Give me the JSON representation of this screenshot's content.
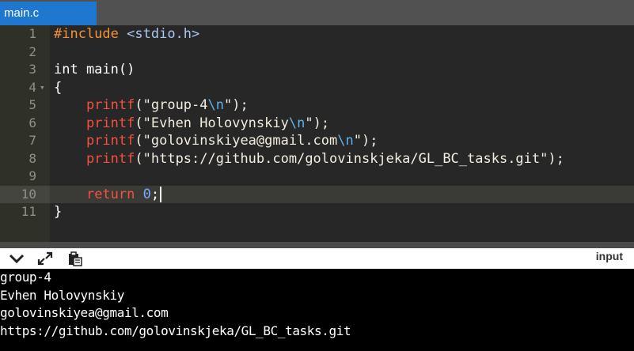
{
  "tab": {
    "label": "main.c"
  },
  "editor": {
    "line_numbers": [
      "1",
      "2",
      "3",
      "4",
      "5",
      "6",
      "7",
      "8",
      "9",
      "10",
      "11"
    ],
    "lines": [
      {
        "include_kw": "#include",
        "header": "<stdio.h>"
      },
      {},
      {
        "text": "int main()"
      },
      {
        "text": "{"
      },
      {
        "fn": "printf",
        "open": "(\"",
        "str": "group-4",
        "esc": "\\n",
        "close": "\");"
      },
      {
        "fn": "printf",
        "open": "(\"",
        "str": "Evhen Holovynskiy",
        "esc": "\\n",
        "close": "\");"
      },
      {
        "fn": "printf",
        "open": "(\"",
        "str": "golovinskiyea@gmail.com",
        "esc": "\\n",
        "close": "\");"
      },
      {
        "fn": "printf",
        "open": "(\"",
        "str": "https://github.com/golovinskjeka/GL_BC_tasks.git",
        "close": "\");"
      },
      {},
      {
        "ret_kw": "return",
        "num": "0",
        "semi": ";"
      },
      {
        "text": "}"
      }
    ]
  },
  "toolbar": {
    "collapse_icon": "chevron-down-icon",
    "expand_icon": "expand-icon",
    "copy_icon": "clipboard-icon",
    "input_label": "input"
  },
  "output": {
    "lines": [
      "group-4",
      "Evhen Holovynskiy",
      "golovinskiyea@gmail.com",
      "https://github.com/golovinskjeka/GL_BC_tasks.git"
    ]
  },
  "colors": {
    "tab_active": "#1f77d0",
    "editor_bg": "#272727",
    "output_bg": "#000000"
  }
}
